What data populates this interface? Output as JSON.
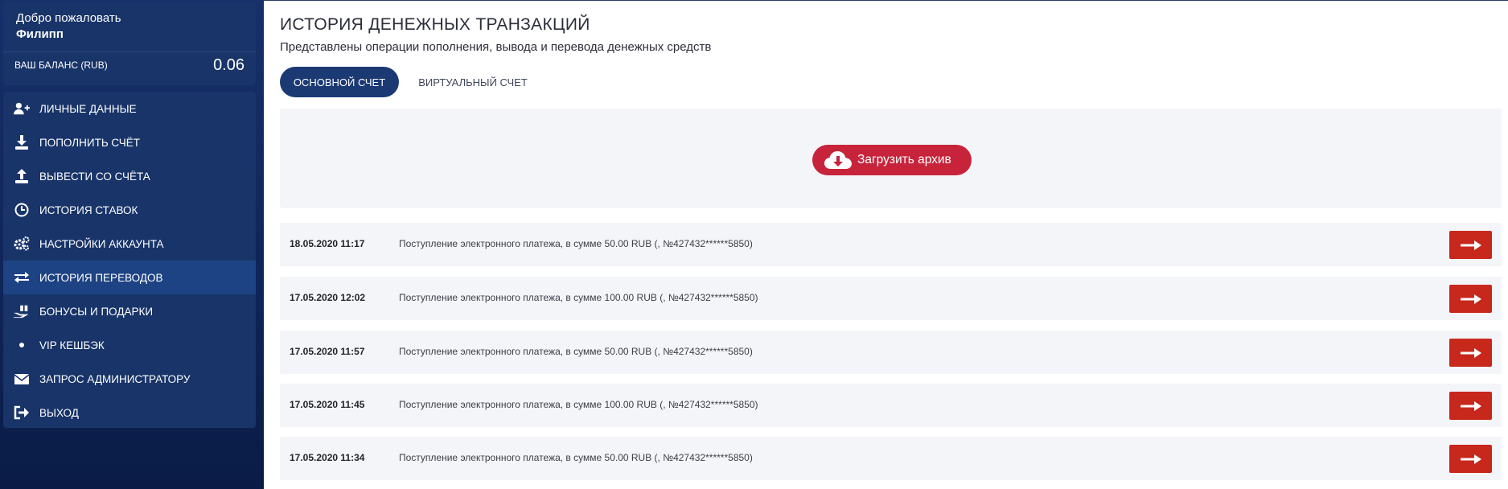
{
  "sidebar": {
    "welcome": "Добро пожаловать",
    "user_name": "Филипп",
    "balance_label": "ВАШ БАЛАНС (RUB)",
    "balance_value": "0.06",
    "menu": [
      {
        "label": "ЛИЧНЫЕ ДАННЫЕ",
        "icon": "user-plus-icon",
        "active": false
      },
      {
        "label": "ПОПОЛНИТЬ СЧЁТ",
        "icon": "download-icon",
        "active": false
      },
      {
        "label": "ВЫВЕСТИ СО СЧЁТА",
        "icon": "upload-icon",
        "active": false
      },
      {
        "label": "ИСТОРИЯ СТАВОК",
        "icon": "clock-icon",
        "active": false
      },
      {
        "label": "НАСТРОЙКИ АККАУНТА",
        "icon": "gears-icon",
        "active": false
      },
      {
        "label": "ИСТОРИЯ ПЕРЕВОДОВ",
        "icon": "transfer-arrows-icon",
        "active": true
      },
      {
        "label": "БОНУСЫ И ПОДАРКИ",
        "icon": "gift-hand-icon",
        "active": false
      },
      {
        "label": "VIP КЕШБЭК",
        "icon": "dot-icon",
        "active": false
      },
      {
        "label": "ЗАПРОС АДМИНИСТРАТОРУ",
        "icon": "envelope-icon",
        "active": false
      },
      {
        "label": "ВЫХОД",
        "icon": "sign-out-icon",
        "active": false
      }
    ]
  },
  "main": {
    "title": "ИСТОРИЯ ДЕНЕЖНЫХ ТРАНЗАКЦИЙ",
    "subtitle": "Представлены операции пополнения, вывода и перевода денежных средств",
    "tabs": [
      {
        "label": "ОСНОВНОЙ СЧЕТ",
        "active": true
      },
      {
        "label": "ВИРТУАЛЬНЫЙ СЧЕТ",
        "active": false
      }
    ],
    "archive_button": "Загрузить архив",
    "transactions": [
      {
        "date": "18.05.2020 11:17",
        "description": "Поступление электронного платежа, в сумме 50.00 RUB (, №427432******5850)"
      },
      {
        "date": "17.05.2020 12:02",
        "description": "Поступление электронного платежа, в сумме 100.00 RUB (, №427432******5850)"
      },
      {
        "date": "17.05.2020 11:57",
        "description": "Поступление электронного платежа, в сумме 50.00 RUB (, №427432******5850)"
      },
      {
        "date": "17.05.2020 11:45",
        "description": "Поступление электронного платежа, в сумме 100.00 RUB (, №427432******5850)"
      },
      {
        "date": "17.05.2020 11:34",
        "description": "Поступление электронного платежа, в сумме 50.00 RUB (, №427432******5850)"
      }
    ]
  },
  "colors": {
    "sidebar_bg": "#183469",
    "active_item": "#1e4384",
    "tab_active": "#1b3a73",
    "archive_button": "#c7243c",
    "row_button": "#c8271c",
    "row_bg": "#f4f5f8"
  }
}
